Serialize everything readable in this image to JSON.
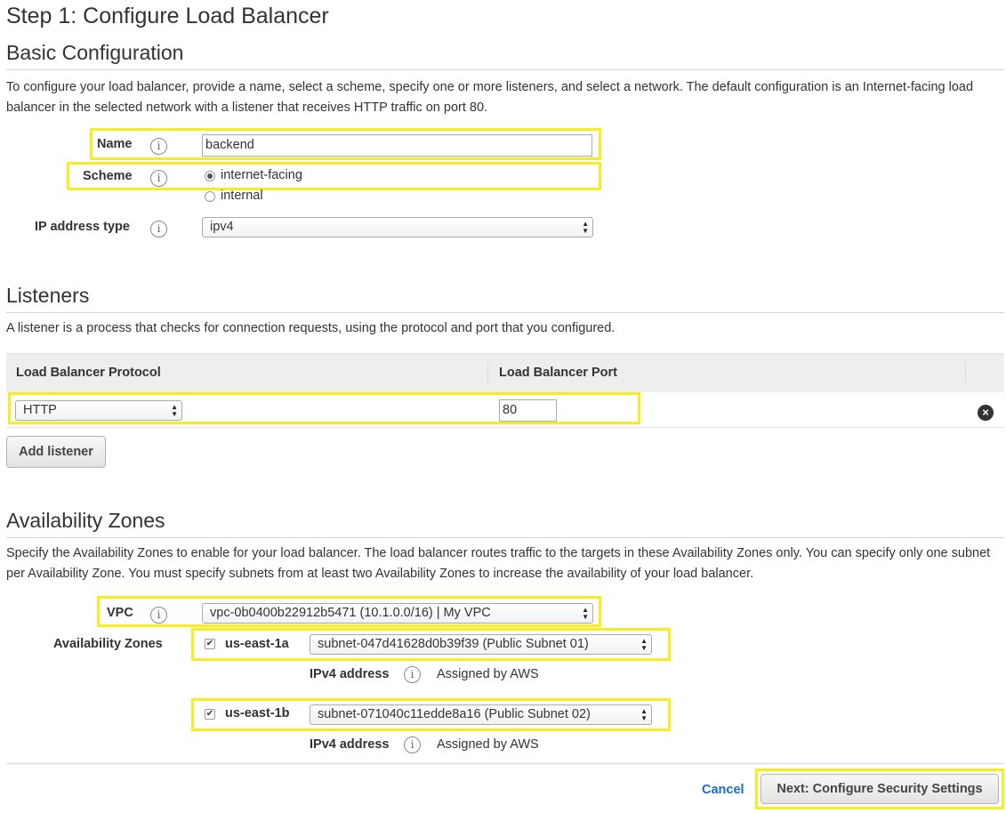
{
  "page": {
    "step_title": "Step 1: Configure Load Balancer"
  },
  "basic": {
    "heading": "Basic Configuration",
    "description": "To configure your load balancer, provide a name, select a scheme, specify one or more listeners, and select a network. The default configuration is an Internet-facing load balancer in the selected network with a listener that receives HTTP traffic on port 80.",
    "name_label": "Name",
    "name_value": "backend",
    "scheme_label": "Scheme",
    "scheme_options": [
      "internet-facing",
      "internal"
    ],
    "scheme_selected": "internet-facing",
    "ip_label": "IP address type",
    "ip_value": "ipv4"
  },
  "listeners": {
    "heading": "Listeners",
    "description": "A listener is a process that checks for connection requests, using the protocol and port that you configured.",
    "columns": [
      "Load Balancer Protocol",
      "Load Balancer Port"
    ],
    "rows": [
      {
        "protocol": "HTTP",
        "port": "80"
      }
    ],
    "add_button": "Add listener"
  },
  "az": {
    "heading": "Availability Zones",
    "description": "Specify the Availability Zones to enable for your load balancer. The load balancer routes traffic to the targets in these Availability Zones only. You can specify only one subnet per Availability Zone. You must specify subnets from at least two Availability Zones to increase the availability of your load balancer.",
    "vpc_label": "VPC",
    "vpc_value": "vpc-0b0400b22912b5471 (10.1.0.0/16) | My VPC",
    "zones_label": "Availability Zones",
    "zones": [
      {
        "name": "us-east-1a",
        "checked": true,
        "subnet": "subnet-047d41628d0b39f39 (Public Subnet 01)",
        "ipv4_label": "IPv4 address",
        "ipv4_value": "Assigned by AWS"
      },
      {
        "name": "us-east-1b",
        "checked": true,
        "subnet": "subnet-071040c11edde8a16 (Public Subnet 02)",
        "ipv4_label": "IPv4 address",
        "ipv4_value": "Assigned by AWS"
      }
    ]
  },
  "footer": {
    "cancel": "Cancel",
    "next": "Next: Configure Security Settings"
  },
  "icons": {
    "info": "info-icon",
    "remove": "remove-circle-icon",
    "select_arrows": "updown-arrows-icon"
  },
  "colors": {
    "highlight": "#f5ef22",
    "link": "#1a6cc0"
  }
}
